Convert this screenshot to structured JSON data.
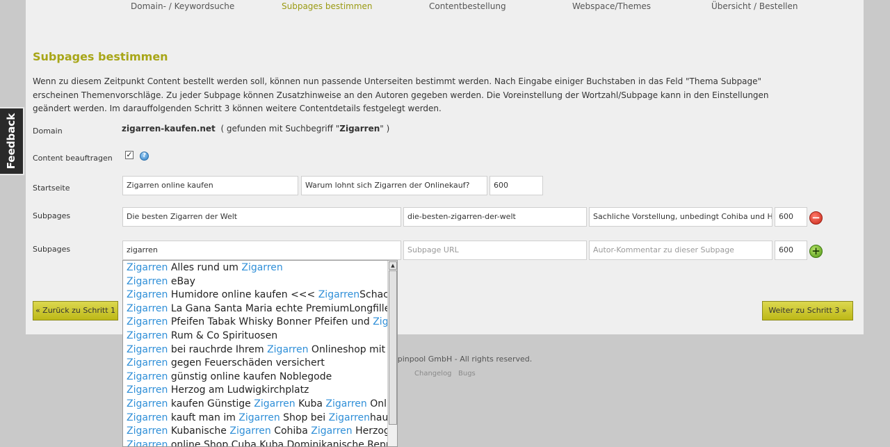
{
  "feedback_label": "Feedback",
  "steps": [
    {
      "label": "Domain- / Keywordsuche",
      "active": false
    },
    {
      "label": "Subpages bestimmen",
      "active": true
    },
    {
      "label": "Contentbestellung",
      "active": false
    },
    {
      "label": "Webspace/Themes",
      "active": false
    },
    {
      "label": "Übersicht / Bestellen",
      "active": false
    }
  ],
  "section_title": "Subpages bestimmen",
  "intro": "Wenn zu diesem Zeitpunkt Content bestellt werden soll, können nun passende Unterseiten bestimmt werden. Nach Eingabe einiger Buchstaben in das Feld \"Thema Subpage\" erscheinen Themenvorschläge. Zu jeder Subpage können Zusatzhinweise an den Autoren gegeben werden. Die Voreinstellung der Wortzahl/Subpage kann in den Einstellungen geändert werden. Im darauffolgenden Schritt 3 können weitere Contentdetails festgelegt werden.",
  "domain": {
    "label": "Domain",
    "name": "zigarren-kaufen.net",
    "found_prefix": "( gefunden mit Suchbegriff \"",
    "keyword": "Zigarren",
    "found_suffix": "\" )"
  },
  "content": {
    "label": "Content beauftragen",
    "checked_mark": "✓",
    "help_icon": "?"
  },
  "startseite": {
    "label": "Startseite",
    "topic": "Zigarren online kaufen",
    "comment": "Warum lohnt sich Zigarren der Onlinekauf?",
    "words": "600"
  },
  "subpage1": {
    "label": "Subpages",
    "topic": "Die besten Zigarren der Welt",
    "url": "die-besten-zigarren-der-welt",
    "comment": "Sachliche Vorstellung, unbedingt Cohiba und H.",
    "words": "600",
    "remove_symbol": "−"
  },
  "subpage2": {
    "label": "Subpages",
    "topic": "zigarren",
    "url_placeholder": "Subpage URL",
    "comment_placeholder": "Autor-Kommentar zu dieser Subpage",
    "words": "600",
    "add_symbol": "+"
  },
  "buttons": {
    "back": "« Zurück zu Schritt 1",
    "next": "Weiter zu Schritt 3 »"
  },
  "footer": {
    "copyright_visible": "spinpool GmbH - All rights reserved.",
    "changelog": "Changelog",
    "bugs": "Bugs"
  },
  "suggestions": [
    [
      [
        "hl",
        "Zigarren"
      ],
      [
        "t",
        " Alles rund um "
      ],
      [
        "hl",
        "Zigarren"
      ]
    ],
    [
      [
        "hl",
        "Zigarren"
      ],
      [
        "t",
        " eBay"
      ]
    ],
    [
      [
        "hl",
        "Zigarren"
      ],
      [
        "t",
        " Humidore online kaufen <<< "
      ],
      [
        "hl",
        "Zigarren"
      ],
      [
        "t",
        "Schachteln"
      ]
    ],
    [
      [
        "hl",
        "Zigarren"
      ],
      [
        "t",
        " La Gana Santa Maria echte PremiumLongfiller"
      ]
    ],
    [
      [
        "hl",
        "Zigarren"
      ],
      [
        "t",
        " Pfeifen Tabak Whisky Bonner Pfeifen und "
      ],
      [
        "hl",
        "Zigarren"
      ]
    ],
    [
      [
        "hl",
        "Zigarren"
      ],
      [
        "t",
        " Rum & Co Spirituosen"
      ]
    ],
    [
      [
        "hl",
        "Zigarren"
      ],
      [
        "t",
        " bei rauchrde Ihrem "
      ],
      [
        "hl",
        "Zigarren"
      ],
      [
        "t",
        " Onlineshop mit Service"
      ]
    ],
    [
      [
        "hl",
        "Zigarren"
      ],
      [
        "t",
        " gegen Feuerschäden versichert"
      ]
    ],
    [
      [
        "hl",
        "Zigarren"
      ],
      [
        "t",
        " günstig online kaufen Noblegode"
      ]
    ],
    [
      [
        "hl",
        "Zigarren"
      ],
      [
        "t",
        " Herzog am Ludwigkirchplatz"
      ]
    ],
    [
      [
        "hl",
        "Zigarren"
      ],
      [
        "t",
        " kaufen Günstige "
      ],
      [
        "hl",
        "Zigarren"
      ],
      [
        "t",
        " Kuba "
      ],
      [
        "hl",
        "Zigarren"
      ],
      [
        "t",
        " Online"
      ]
    ],
    [
      [
        "hl",
        "Zigarren"
      ],
      [
        "t",
        " kauft man im "
      ],
      [
        "hl",
        "Zigarren"
      ],
      [
        "t",
        " Shop bei "
      ],
      [
        "hl",
        "Zigarren"
      ],
      [
        "t",
        "haus"
      ]
    ],
    [
      [
        "hl",
        "Zigarren"
      ],
      [
        "t",
        " Kubanische "
      ],
      [
        "hl",
        "Zigarren"
      ],
      [
        "t",
        " Cohiba "
      ],
      [
        "hl",
        "Zigarren"
      ],
      [
        "t",
        " Herzog"
      ]
    ],
    [
      [
        "hl",
        "Zigarren"
      ],
      [
        "t",
        " online Shop Cuba Kuba Dominikanische Republik"
      ]
    ]
  ],
  "scroll_up_arrow": "▲"
}
